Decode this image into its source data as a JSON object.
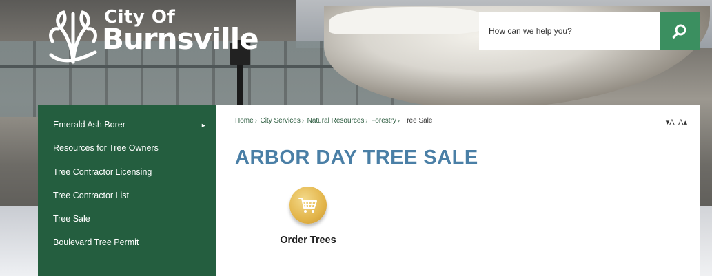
{
  "brand": {
    "city_of": "City Of",
    "name": "Burnsville"
  },
  "search": {
    "placeholder": "How can we help you?"
  },
  "sidebar": {
    "items": [
      {
        "label": "Emerald Ash Borer"
      },
      {
        "label": "Resources for Tree Owners"
      },
      {
        "label": "Tree Contractor Licensing"
      },
      {
        "label": "Tree Contractor List"
      },
      {
        "label": "Tree Sale"
      },
      {
        "label": "Boulevard Tree Permit"
      }
    ]
  },
  "breadcrumb": {
    "items": [
      "Home",
      "City Services",
      "Natural Resources",
      "Forestry"
    ],
    "current": "Tree Sale"
  },
  "text_resize": {
    "decrease": "▾A",
    "increase": "A▴"
  },
  "page": {
    "title": "ARBOR DAY TREE SALE"
  },
  "order": {
    "label": "Order Trees",
    "icon": "shopping-cart-icon"
  },
  "colors": {
    "sidebar_bg": "#245e3f",
    "search_button": "#3b8f60",
    "title": "#4a7fa6",
    "order_icon": "#e3b54a"
  }
}
